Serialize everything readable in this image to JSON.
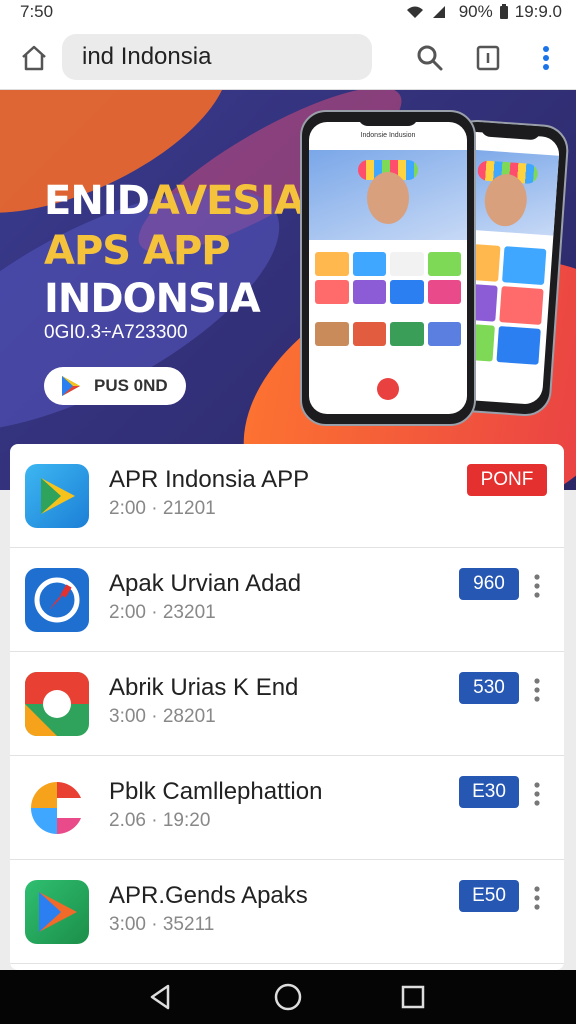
{
  "status_bar": {
    "time": "7:50",
    "battery": "90%",
    "clock": "19:9.0",
    "icons": [
      "wifi-icon",
      "signal-icon"
    ]
  },
  "browser": {
    "url": "ind Indonsia",
    "icons": [
      "home-icon",
      "search-icon",
      "tabs-icon",
      "more-vert-icon"
    ]
  },
  "banner": {
    "title_line1_white": "ENID",
    "title_line1_yellow": "AVESIA",
    "title_line2": "APS APP",
    "title_line3": "INDONSIA",
    "code": "0GI0.3÷A723300",
    "button_label": "PUS 0ND",
    "front_phone_header": "Indonsie Indusion",
    "colors": {
      "yellow": "#f5c33b",
      "orange": "#f16a2a",
      "purple": "#33317a"
    }
  },
  "apps": [
    {
      "title": "APR Indonsia APP",
      "subtitle": "2:00  ·  21201",
      "badge": "PONF",
      "badge_color": "#e53030",
      "icon": "play-store-icon"
    },
    {
      "title": "Apak Urvian Adad",
      "subtitle": "2:00  ·  23201",
      "badge": "960",
      "badge_color": "#2557b3",
      "icon": "compass-icon"
    },
    {
      "title": "Abrik Urias K End",
      "subtitle": "3:00  ·  28201",
      "badge": "530",
      "badge_color": "#2557b3",
      "icon": "ring-icon"
    },
    {
      "title": "Pblk Camllephattion",
      "subtitle": "2.06  ·  19:20",
      "badge": "E30",
      "badge_color": "#2557b3",
      "icon": "colorful-c-icon"
    },
    {
      "title": "APR.Gends Apaks",
      "subtitle": "3:00  ·  35211",
      "badge": "E50",
      "badge_color": "#2557b3",
      "icon": "play-triangle-icon"
    }
  ],
  "nav_bar": {
    "icons": [
      "back-icon",
      "home-circle-icon",
      "recents-icon"
    ]
  }
}
